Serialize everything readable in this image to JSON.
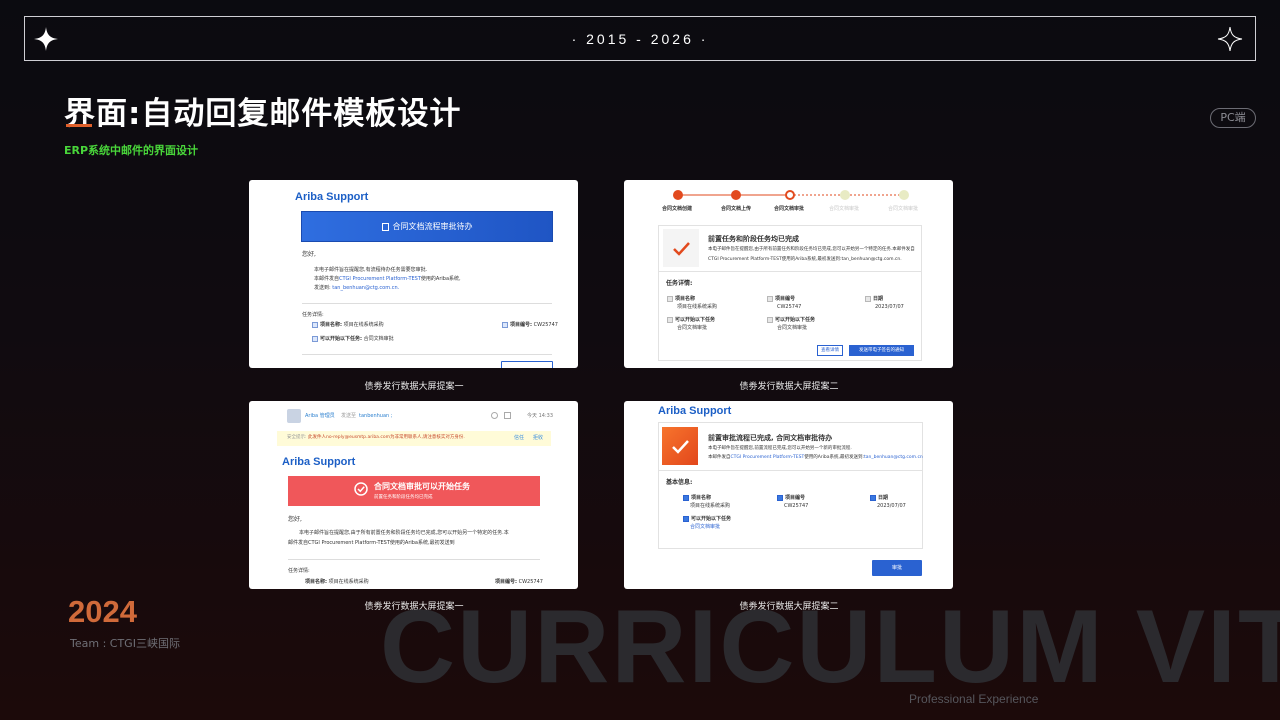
{
  "header": {
    "years": "· 2015 - 2026 ·",
    "title": "界面:自动回复邮件模板设计",
    "subtitle": "ERP系统中邮件的界面设计",
    "pc_badge": "PC端"
  },
  "cards": {
    "card1": {
      "caption": "债劵发行数据大屏提案一",
      "brand": "Ariba Support",
      "banner": "合同文档流程审批待办",
      "greeting": "您好,",
      "line1": "本电子邮件旨在提醒您,有流程待办任务需要您审批.",
      "line2_prefix": "本邮件发自",
      "line2_link": "CTGI Procurement Platform-TEST",
      "line2_suffix": "使用的Ariba系统,",
      "line3_prefix": "发送到: ",
      "line3_link": "tan_benhuan@ctg.com.cn.",
      "details_label": "任务详情:",
      "item_name_label": "项目名称:",
      "item_name": "项目在线系统采购",
      "item_no_label": "项目编号:",
      "item_no": "CW25747",
      "task_label": "可以开始以下任务:",
      "task": "合同文档审批"
    },
    "card2": {
      "caption": "债劵发行数据大屏提案二",
      "steps": [
        "合同文档创建",
        "合同文档上传",
        "合同文档审批",
        "合同文档审批",
        "合同文档审批"
      ],
      "headline": "前置任务和阶段任务均已完成",
      "body1": "本电子邮件旨在提醒您,由于所有前置任务和阶段任务均已完成,您可以开始另一个特定的任务.本邮件发自",
      "body2": "CTGI Procurement Platform-TEST使用的Ariba系统,最初发送到:tan_benhuan@ctg.com.cn.",
      "details_label": "任务详情:",
      "f1_label": "项目名称",
      "f1_value": "项目在线系统采购",
      "f2_label": "项目编号",
      "f2_value": "CW25747",
      "f3_label": "日期",
      "f3_value": "2023/07/07",
      "f4_label": "可以开始以下任务",
      "f4_value": "合同文档审批",
      "f5_label": "可以开始以下任务",
      "f5_value": "合同文档审批",
      "btn_view": "查看详情",
      "btn_send": "发送带电子签名的通知"
    },
    "card3": {
      "caption": "债劵发行数据大屏提案一",
      "sender": "Ariba 管理员",
      "to_label": "发送至",
      "to_value": "tanbenhuan ;",
      "time": "今天 14:33",
      "warning_prefix": "安全提示:",
      "warning_text": "此发件人no-reply@eusmtp.ariba.com为非常用联系人,请注意核实对方身份.",
      "warning_action1": "信任",
      "warning_action2": "拒收",
      "brand": "Ariba Support",
      "banner_title": "合同文档审批可以开始任务",
      "banner_sub": "前置任务和阶段任务均已完成",
      "greeting": "您好,",
      "body1": "本电子邮件旨在提醒您,由于所有前置任务和阶段任务均已完成,您可以开始另一个特定的任务.本",
      "body2": "邮件发自CTGI Procurement Platform-TEST使用的Ariba系统,最初发送到",
      "details_label": "任务详情:",
      "item_name_label": "项目名称:",
      "item_name": "项目在线系统采购",
      "item_no_label": "项目编号:",
      "item_no": "CW25747"
    },
    "card4": {
      "caption": "债劵发行数据大屏提案二",
      "brand": "Ariba Support",
      "headline": "前置审批流程已完成, 合同文档审批待办",
      "body1": "本电子邮件旨在提醒您,前置流程已完成,您可以开始另一个新的审批流程.",
      "body2_prefix": "本邮件发自",
      "body2_link1": "CTGI Procurement Platform-TEST",
      "body2_mid": "使用的Ariba系统,最初发送到:",
      "body2_link2": "tan_benhuan@ctg.com.cn",
      "basic_label": "基本信息:",
      "f1_label": "项目名称",
      "f1_value": "项目在线系统采购",
      "f2_label": "项目编号",
      "f2_value": "CW25747",
      "f3_label": "日期",
      "f3_value": "2023/07/07",
      "f4_label": "可以开始以下任务",
      "f4_value": "合同文档审批",
      "btn_approve": "审批"
    }
  },
  "footer": {
    "year": "2024",
    "team": "Team : CTGI三峡国际",
    "bg_text": "CURRICULUM VIT",
    "pro_exp": "Professional Experience"
  },
  "colors": {
    "accent_orange": "#e0602b",
    "ariba_blue": "#1c5fc6",
    "green_sub": "#49d63a",
    "red_banner": "#f0575a"
  }
}
